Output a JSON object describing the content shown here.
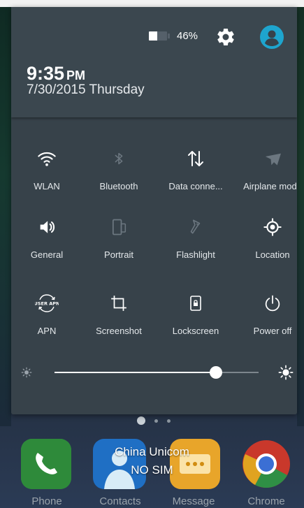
{
  "status": {
    "battery_percent_text": "46%",
    "battery_level": 0.46,
    "time": "9:35",
    "ampm": "PM",
    "date": "7/30/2015 Thursday"
  },
  "icons": {
    "settings": "gear-icon",
    "account": "account-circle-icon"
  },
  "colors": {
    "accent_account": "#1ea5ce",
    "active_icon": "#ffffff",
    "inactive_icon": "#6c7780",
    "shade_bg": "#37424a"
  },
  "quick_settings": [
    {
      "label": "WLAN",
      "icon": "wifi-icon",
      "active": true
    },
    {
      "label": "Bluetooth",
      "icon": "bluetooth-icon",
      "active": false
    },
    {
      "label": "Data conne...",
      "icon": "data-transfer-icon",
      "active": true
    },
    {
      "label": "Airplane mode",
      "icon": "airplane-icon",
      "active": false
    },
    {
      "label": "General",
      "icon": "volume-icon",
      "active": true
    },
    {
      "label": "Portrait",
      "icon": "rotation-icon",
      "active": false
    },
    {
      "label": "Flashlight",
      "icon": "flashlight-icon",
      "active": false
    },
    {
      "label": "Location",
      "icon": "location-icon",
      "active": true
    },
    {
      "label": "APN",
      "icon": "apn-icon",
      "active": true,
      "icon_text": "USER APN"
    },
    {
      "label": "Screenshot",
      "icon": "crop-icon",
      "active": true
    },
    {
      "label": "Lockscreen",
      "icon": "lock-phone-icon",
      "active": true
    },
    {
      "label": "Power off",
      "icon": "power-icon",
      "active": true
    }
  ],
  "brightness": {
    "level": 0.79
  },
  "pager": {
    "pages": 3,
    "active_index": 0
  },
  "carrier": {
    "name": "China Unicom",
    "sim_status": "NO SIM"
  },
  "dock": [
    {
      "label": "Phone",
      "icon": "phone-icon",
      "color": "#2e8a3a"
    },
    {
      "label": "Contacts",
      "icon": "contacts-icon",
      "color": "#1f6fc4"
    },
    {
      "label": "Message",
      "icon": "message-icon",
      "color": "#e8a52a"
    },
    {
      "label": "Chrome",
      "icon": "chrome-icon",
      "color": "#cc3b2e"
    }
  ]
}
